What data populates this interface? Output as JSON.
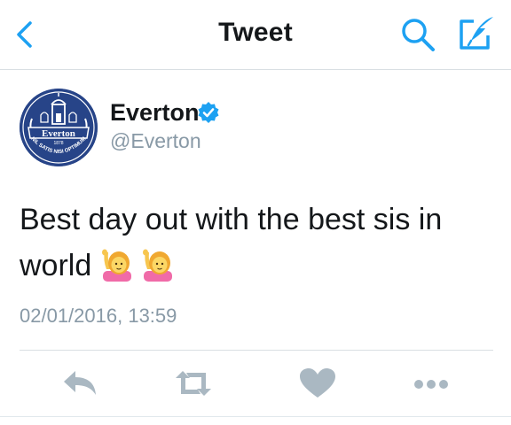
{
  "navbar": {
    "title": "Tweet",
    "back_icon": "chevron-left-icon",
    "search_icon": "search-icon",
    "compose_icon": "compose-icon"
  },
  "tweet": {
    "display_name": "Everton",
    "handle": "@Everton",
    "verified": true,
    "avatar": {
      "logo_text_lines": [
        "Everton",
        "1878",
        "NIL SATIS NISI OPTIMUM"
      ]
    },
    "text_line1": "Best day out with the best sis in",
    "text_line2": "world",
    "emojis": [
      "raising-hand-emoji",
      "raising-hand-emoji"
    ],
    "timestamp": "02/01/2016, 13:59"
  },
  "actions": {
    "reply": "reply-icon",
    "retweet": "retweet-icon",
    "like": "heart-icon",
    "more": "more-icon"
  },
  "colors": {
    "accent": "#1da1f2",
    "text": "#14171a",
    "secondary_text": "#8899a6",
    "action_icons": "#aab8c2",
    "avatar_blue": "#274488"
  }
}
